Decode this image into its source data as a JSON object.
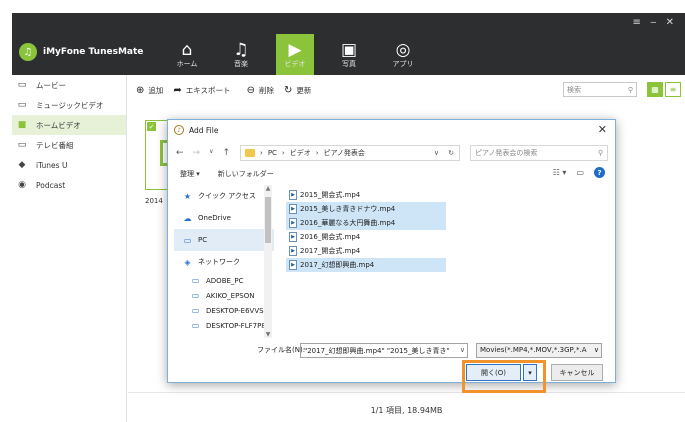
{
  "window": {
    "controls": "≡ ‒ ✕",
    "brand": "iMyFone TunesMate",
    "brand_icon": "music-note-icon"
  },
  "nav_tabs": [
    {
      "label": "ホーム",
      "icon": "⌂",
      "active": false
    },
    {
      "label": "音楽",
      "icon": "♫",
      "active": false
    },
    {
      "label": "ビデオ",
      "icon": "▶",
      "active": true
    },
    {
      "label": "写真",
      "icon": "▣",
      "active": false
    },
    {
      "label": "アプリ",
      "icon": "◎",
      "active": false
    }
  ],
  "sidebar": {
    "items": [
      {
        "label": "ムービー",
        "icon": "▭"
      },
      {
        "label": "ミュージックビデオ",
        "icon": "▭"
      },
      {
        "label": "ホームビデオ",
        "icon": "■"
      },
      {
        "label": "テレビ番組",
        "icon": "▭"
      },
      {
        "label": "iTunes U",
        "icon": "◆"
      },
      {
        "label": "Podcast",
        "icon": "◉"
      }
    ],
    "active_index": 2
  },
  "toolbar": {
    "add": "追加",
    "export": "エキスポート",
    "delete": "削除",
    "refresh": "更新",
    "search_placeholder": "検索"
  },
  "content": {
    "item_label": "2014"
  },
  "status": {
    "text": "1/1 項目, 18.94MB"
  },
  "dialog": {
    "title": "Add File",
    "path": [
      "PC",
      "ビデオ",
      "ピアノ発表会"
    ],
    "search_placeholder": "ピアノ発表会の検索",
    "organize": "整理 ▾",
    "new_folder": "新しいフォルダー",
    "nav_items": [
      {
        "label": "クイック アクセス",
        "icon": "★",
        "color": "#2b73c9",
        "sub": false
      },
      {
        "label": "OneDrive",
        "icon": "☁",
        "color": "#2b73c9",
        "sub": false
      },
      {
        "label": "PC",
        "icon": "▭",
        "color": "#2b73c9",
        "sub": false
      },
      {
        "label": "ネットワーク",
        "icon": "◈",
        "color": "#2b73c9",
        "sub": false
      },
      {
        "label": "ADOBE_PC",
        "icon": "▭",
        "color": "#2b73c9",
        "sub": true
      },
      {
        "label": "AKIKO_EPSON",
        "icon": "▭",
        "color": "#2b73c9",
        "sub": true
      },
      {
        "label": "DESKTOP-E6VVS",
        "icon": "▭",
        "color": "#2b73c9",
        "sub": true
      },
      {
        "label": "DESKTOP-FLF7P8",
        "icon": "▭",
        "color": "#2b73c9",
        "sub": true
      }
    ],
    "nav_selected_index": 2,
    "files": [
      {
        "name": "2015_開会式.mp4",
        "selected": false
      },
      {
        "name": "2015_美しき青きドナウ.mp4",
        "selected": true
      },
      {
        "name": "2016_華麗なる大円舞曲.mp4",
        "selected": true
      },
      {
        "name": "2016_開会式.mp4",
        "selected": false
      },
      {
        "name": "2017_開会式.mp4",
        "selected": false
      },
      {
        "name": "2017_幻想即興曲.mp4",
        "selected": true
      }
    ],
    "filename_label": "ファイル名(N):",
    "filename_value": "\"2017_幻想即興曲.mp4\" \"2015_美しき青き\"",
    "filetype_value": "Movies(*.MP4,*.MOV,*.3GP,*.A",
    "open_label": "開く(O)",
    "cancel_label": "キャンセル"
  },
  "colors": {
    "accent": "#8bc43a",
    "header": "#2d2e30",
    "highlight": "#f0932b"
  }
}
